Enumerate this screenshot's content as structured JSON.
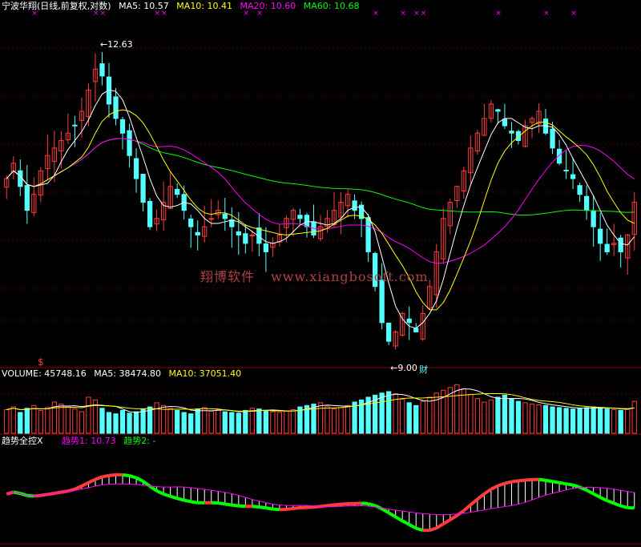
{
  "header": {
    "stock_title": "宁波华翔(日线,前复权,对数)",
    "ma5": "MA5: 10.57",
    "ma10": "MA10: 10.41",
    "ma20": "MA20: 10.60",
    "ma60": "MA60: 10.68"
  },
  "volume_header": {
    "volume": "VOLUME: 45748.16",
    "ma5": "MA5: 38474.80",
    "ma10": "MA10: 37051.40"
  },
  "indicator_header": {
    "name": "趋势全控X",
    "trend1": "趋势1: 10.73",
    "trend2": "趋势2: -"
  },
  "watermark": {
    "cn": "翔博软件",
    "url": "www.xiangbosoft.com"
  },
  "colors": {
    "background": "#000000",
    "up_candle": "#ff3c3c",
    "down_candle": "#54ffff",
    "ma5": "#ffffff",
    "ma10": "#ffff00",
    "ma20": "#ff00ff",
    "ma60": "#00ff00",
    "separator": "#8b0000"
  },
  "chart_data": [
    {
      "type": "candlestick",
      "title": "宁波华翔(日线,前复权,对数)",
      "y_scale": "log",
      "grid": true,
      "annotations": [
        {
          "text": "12.63",
          "kind": "high"
        },
        {
          "text": "9.00",
          "kind": "low"
        },
        {
          "text": "财",
          "kind": "marker"
        },
        {
          "text": "$",
          "kind": "marker"
        }
      ],
      "close_series": [
        10.9,
        11.1,
        10.8,
        10.5,
        10.7,
        11.0,
        11.2,
        11.3,
        11.4,
        11.5,
        11.6,
        11.8,
        12.1,
        12.4,
        12.3,
        11.9,
        11.7,
        11.5,
        11.2,
        10.9,
        10.6,
        10.3,
        10.4,
        10.6,
        10.8,
        10.7,
        10.5,
        10.3,
        10.2,
        10.3,
        10.4,
        10.5,
        10.4,
        10.3,
        10.2,
        10.1,
        10.2,
        10.1,
        10.0,
        10.1,
        10.2,
        10.4,
        10.5,
        10.4,
        10.3,
        10.2,
        10.3,
        10.4,
        10.5,
        10.6,
        10.7,
        10.5,
        10.4,
        10.0,
        9.6,
        9.2,
        9.0,
        9.1,
        9.3,
        9.2,
        9.1,
        9.3,
        9.6,
        10.0,
        10.4,
        10.6,
        10.8,
        11.0,
        11.3,
        11.5,
        11.7,
        11.9,
        11.8,
        11.6,
        11.5,
        11.4,
        11.6,
        11.7,
        11.8,
        11.5,
        11.3,
        11.1,
        11.0,
        10.9,
        10.7,
        10.5,
        10.3,
        10.1,
        10.0,
        10.1,
        10.0,
        10.2,
        10.6
      ]
    },
    {
      "type": "bar",
      "title": "VOLUME",
      "series_names": [
        "VOLUME",
        "MA5",
        "MA10"
      ],
      "values": [
        34,
        38,
        30,
        36,
        40,
        33,
        37,
        45,
        42,
        39,
        35,
        31,
        52,
        48,
        36,
        30,
        28,
        33,
        29,
        31,
        35,
        38,
        44,
        40,
        36,
        33,
        30,
        28,
        35,
        37,
        32,
        34,
        31,
        30,
        29,
        33,
        36,
        35,
        33,
        31,
        30,
        32,
        34,
        38,
        40,
        42,
        44,
        39,
        35,
        37,
        40,
        45,
        48,
        52,
        55,
        58,
        60,
        57,
        49,
        44,
        40,
        46,
        52,
        58,
        62,
        66,
        70,
        64,
        56,
        50,
        45,
        48,
        52,
        55,
        50,
        46,
        44,
        42,
        41,
        40,
        38,
        37,
        36,
        35,
        36,
        37,
        38,
        36,
        35,
        34,
        33,
        35,
        46
      ]
    },
    {
      "type": "line",
      "title": "趋势全控X",
      "series": [
        {
          "name": "趋势1",
          "last": 10.73
        },
        {
          "name": "趋势2",
          "last": null
        }
      ]
    }
  ]
}
